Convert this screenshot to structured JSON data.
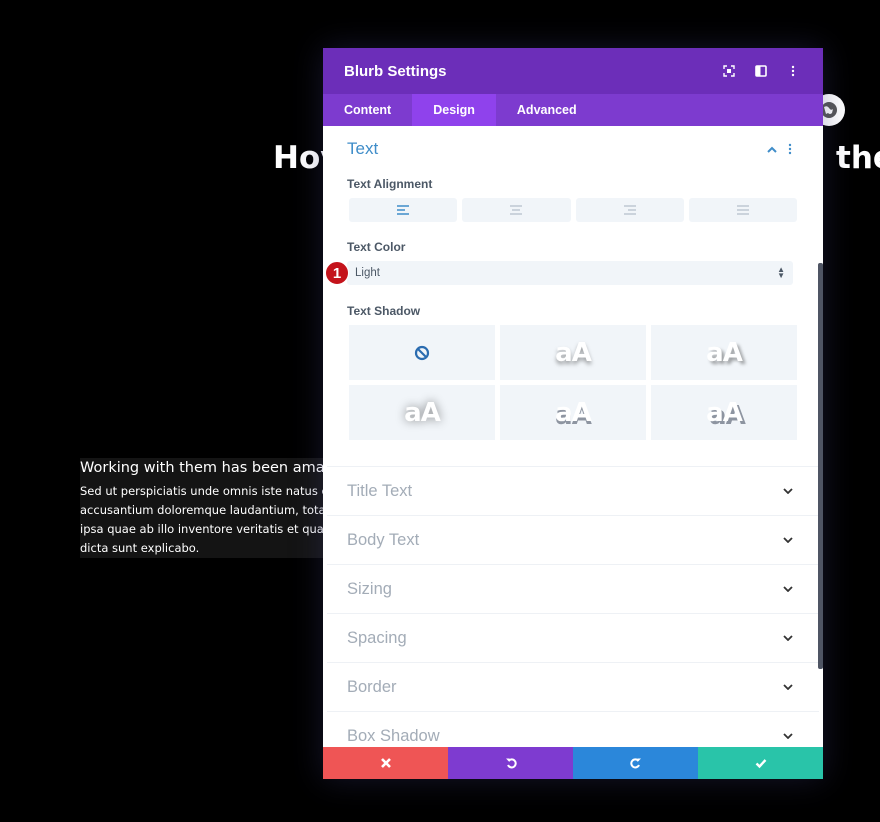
{
  "background": {
    "heading_left": "Hov",
    "heading_right": "the",
    "blurb_title": "Working with them has been amazing",
    "blurb_body_lines": [
      "Sed ut perspiciatis unde omnis iste natus error",
      "accusantium doloremque laudantium, totam rem",
      "ipsa quae ab illo inventore veritatis et quasi arch",
      "dicta sunt explicabo."
    ]
  },
  "modal": {
    "title": "Blurb Settings",
    "header_icons": [
      "focus-icon",
      "split-view-icon",
      "more-vertical-icon"
    ],
    "tabs": [
      {
        "label": "Content",
        "active": false
      },
      {
        "label": "Design",
        "active": true
      },
      {
        "label": "Advanced",
        "active": false
      }
    ],
    "open_section": {
      "title": "Text",
      "text_alignment": {
        "label": "Text Alignment",
        "options": [
          "left",
          "center",
          "right",
          "justify"
        ],
        "selected": "left"
      },
      "text_color": {
        "label": "Text Color",
        "value": "Light",
        "badge": "1"
      },
      "text_shadow": {
        "label": "Text Shadow",
        "preview_text": "aA",
        "options": [
          "none",
          "shadow-1",
          "shadow-2",
          "shadow-3",
          "shadow-4",
          "shadow-5"
        ],
        "selected": "none"
      }
    },
    "collapsed_sections": [
      "Title Text",
      "Body Text",
      "Sizing",
      "Spacing",
      "Border",
      "Box Shadow"
    ],
    "footer": {
      "cancel_color": "#ef5555",
      "undo_color": "#7e3bd0",
      "redo_color": "#2b87da",
      "save_color": "#29c4a9"
    }
  },
  "colors": {
    "header": "#6c2eb9",
    "tabs": "#7d3bcf",
    "tab_active": "#8f42ec",
    "open_section_title": "#3f8dc9",
    "badge": "#c4131b"
  }
}
